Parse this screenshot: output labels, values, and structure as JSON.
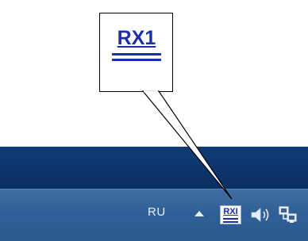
{
  "callout": {
    "label": "RX1"
  },
  "taskbar": {
    "language": "RU",
    "tray_icons": [
      {
        "name": "show-hidden-icons",
        "icon": "up-arrow-icon"
      },
      {
        "name": "rx1-tray-icon",
        "label": "RXI",
        "icon": "rx1-icon"
      },
      {
        "name": "volume-icon",
        "icon": "speaker-icon"
      },
      {
        "name": "network-icon",
        "icon": "network-icon"
      }
    ]
  },
  "colors": {
    "taskbar": "#2f5f95",
    "window_band": "#0e3c78",
    "brand_blue": "#1b2fa6"
  }
}
